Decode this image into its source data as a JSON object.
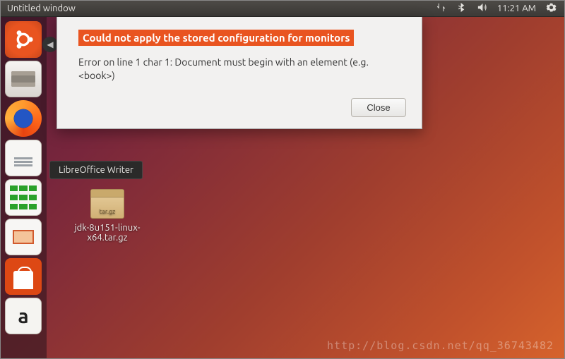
{
  "topbar": {
    "title": "Untitled window",
    "clock": "11:21 AM"
  },
  "dialog": {
    "headline": "Could not apply the stored configuration for monitors",
    "body": "Error on line 1 char 1: Document must begin with an element (e.g. <book>)",
    "close_label": "Close"
  },
  "tooltip": {
    "text": "LibreOffice Writer"
  },
  "desktop": {
    "file_label": "jdk-8u151-linux-x64.tar.gz",
    "archive_badge": "tar.gz"
  },
  "launcher": {
    "items": [
      {
        "name": "ubuntu-dash"
      },
      {
        "name": "files"
      },
      {
        "name": "firefox"
      },
      {
        "name": "libreoffice-writer"
      },
      {
        "name": "libreoffice-calc"
      },
      {
        "name": "libreoffice-impress"
      },
      {
        "name": "ubuntu-software"
      },
      {
        "name": "amazon"
      }
    ]
  },
  "watermark": "http://blog.csdn.net/qq_36743482"
}
